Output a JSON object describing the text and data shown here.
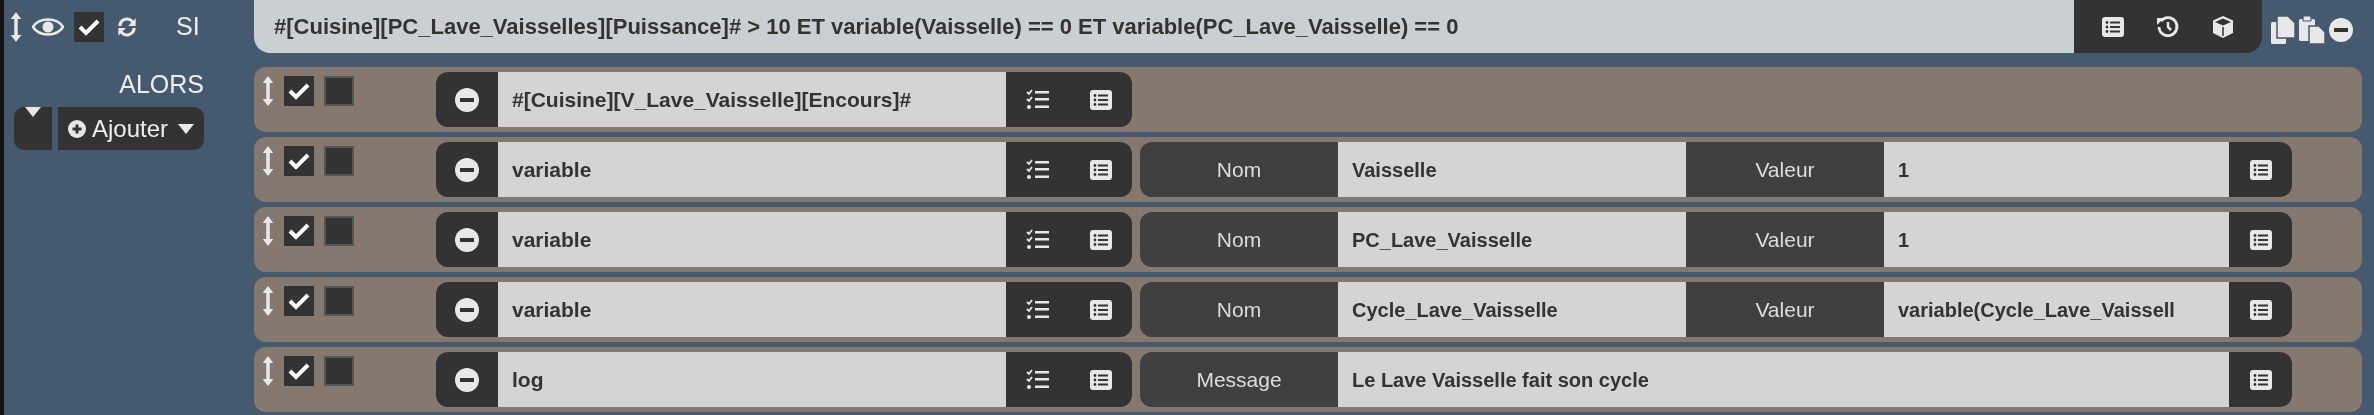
{
  "condition": {
    "enabled": true,
    "label": "SI",
    "expression": "#[Cuisine][PC_Lave_Vaisselles][Puissance]# > 10 ET variable(Vaisselle) == 0 ET variable(PC_Lave_Vaisselle) == 0"
  },
  "then_label": "ALORS",
  "add_button": "Ajouter",
  "actions": [
    {
      "enabled": true,
      "parallel": false,
      "command": "#[Cuisine][V_Lave_Vaisselle][Encours]#"
    },
    {
      "enabled": true,
      "parallel": false,
      "command": "variable",
      "options": [
        {
          "label": "Nom",
          "value": "Vaisselle"
        },
        {
          "label": "Valeur",
          "value": "1"
        }
      ]
    },
    {
      "enabled": true,
      "parallel": false,
      "command": "variable",
      "options": [
        {
          "label": "Nom",
          "value": "PC_Lave_Vaisselle"
        },
        {
          "label": "Valeur",
          "value": "1"
        }
      ]
    },
    {
      "enabled": true,
      "parallel": false,
      "command": "variable",
      "options": [
        {
          "label": "Nom",
          "value": "Cycle_Lave_Vaisselle"
        },
        {
          "label": "Valeur",
          "value": "variable(Cycle_Lave_Vaissell"
        }
      ]
    },
    {
      "enabled": true,
      "parallel": false,
      "command": "log",
      "options": [
        {
          "label": "Message",
          "value": "Le Lave Vaisselle fait son cycle"
        }
      ]
    }
  ]
}
